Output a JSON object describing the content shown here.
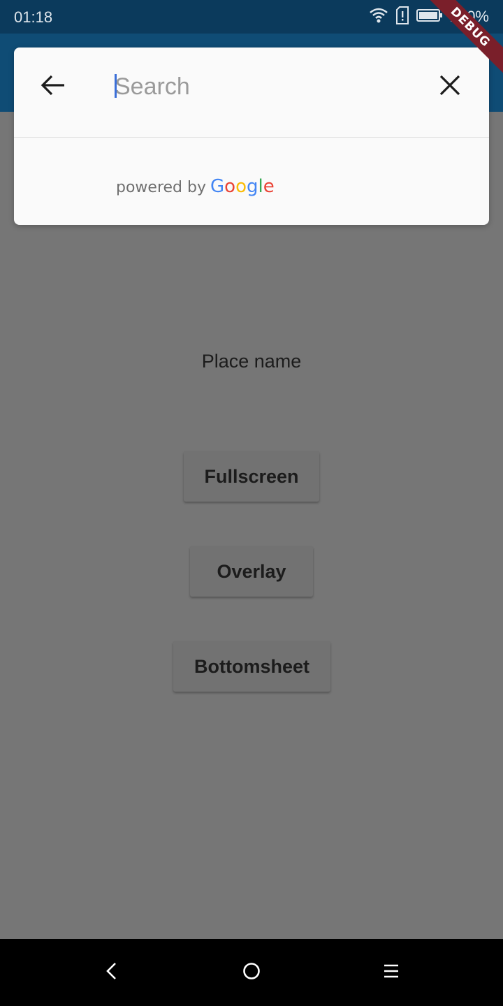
{
  "status_bar": {
    "time": "01:18",
    "battery_text": "100%",
    "icons": [
      "wifi-icon",
      "sim-alert-icon",
      "battery-icon"
    ]
  },
  "debug_banner": {
    "label": "DEBUG"
  },
  "search": {
    "placeholder": "Search",
    "value": "",
    "back_icon": "arrow-back-icon",
    "clear_icon": "close-icon",
    "powered_by": "powered by",
    "google_letters": [
      "G",
      "o",
      "o",
      "g",
      "l",
      "e"
    ]
  },
  "place_name": "Place name",
  "buttons": {
    "fullscreen": "Fullscreen",
    "overlay": "Overlay",
    "bottomsheet": "Bottomsheet"
  },
  "nav_bar": {
    "icons": [
      "nav-back-icon",
      "nav-home-icon",
      "nav-menu-icon"
    ]
  },
  "colors": {
    "status_bar": "#0b3a5c",
    "app_bar": "#0f4c75",
    "scrim_background": "#767676",
    "caret": "#3b6fd8",
    "google_blue": "#4285F4",
    "google_red": "#EA4335",
    "google_yellow": "#FBBC05",
    "google_green": "#34A853"
  }
}
